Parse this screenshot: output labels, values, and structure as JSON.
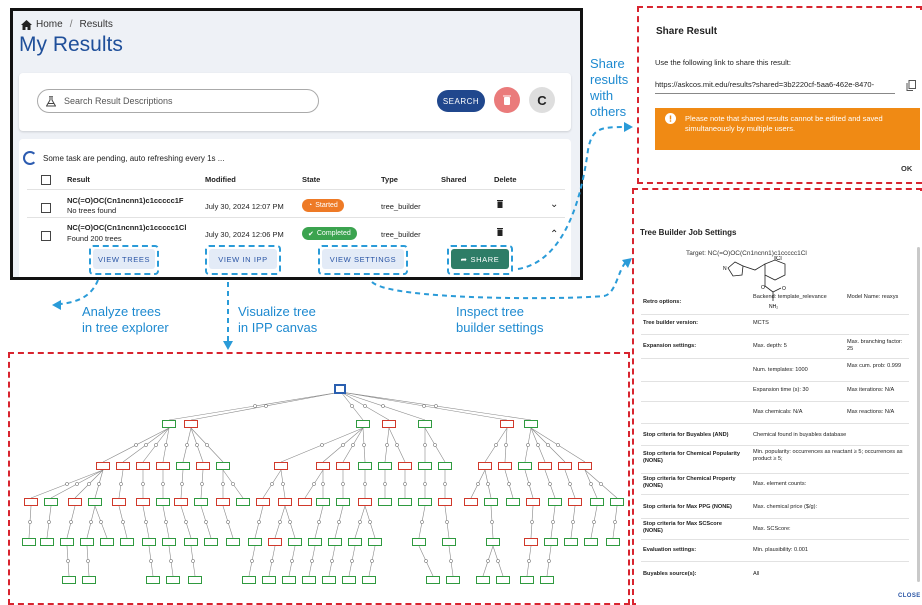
{
  "main": {
    "breadcrumb": {
      "home": "Home",
      "sep": "/",
      "current": "Results"
    },
    "title": "My Results",
    "search": {
      "placeholder": "Search Result Descriptions",
      "button": "SEARCH"
    },
    "pending_text": "Some task are pending, auto refreshing every 1s ...",
    "columns": [
      "Result",
      "Modified",
      "State",
      "Type",
      "Shared",
      "Delete"
    ],
    "rows": [
      {
        "result": "NC(=O)OC(Cn1ncnn1)c1ccccc1F",
        "sub": "No trees found",
        "modified": "July 30, 2024 12:07 PM",
        "state": "Started",
        "type": "tree_builder",
        "chevron": "⌄"
      },
      {
        "result": "NC(=O)OC(Cn1ncnn1)c1ccccc1Cl",
        "sub": "Found 200 trees",
        "modified": "July 30, 2024 12:06 PM",
        "state": "Completed",
        "type": "tree_builder",
        "chevron": "⌃"
      }
    ],
    "actions": {
      "view_trees": "VIEW TREES",
      "view_ipp": "VIEW IN IPP",
      "view_settings": "VIEW SETTINGS",
      "share": "SHARE"
    },
    "colors": {
      "started": "#ee7a26",
      "completed": "#3ba34f",
      "title": "#1f4f9a"
    }
  },
  "annotations": {
    "share": "Share\nresults\nwith\nothers",
    "trees": "Analyze trees\nin tree explorer",
    "ipp": "Visualize tree\nin IPP canvas",
    "settings": "Inspect tree\nbuilder settings"
  },
  "share_dialog": {
    "title": "Share Result",
    "instruction": "Use the following link to share this result:",
    "link": "https://askcos.mit.edu/results?shared=3b2220cf-5aa6-462e-8470-",
    "warning": "Please note that shared results cannot be edited and saved simultaneously by multiple users.",
    "ok": "OK"
  },
  "settings_dialog": {
    "title": "Tree Builder Job Settings",
    "target": "Target: NC(=O)OC(Cn1ncnn1)c1ccccc1Cl",
    "rows": [
      {
        "label": "Retro options:",
        "v1": "Backend: template_relevance",
        "v2": "Model Name: reaxys"
      },
      {
        "label": "Tree builder version:",
        "v1": "MCTS",
        "v2": ""
      },
      {
        "label": "Expansion settings:",
        "v1": "Max. depth: 5",
        "v2": "Max. branching factor: 25"
      },
      {
        "label": "",
        "v1": "Num. templates: 1000",
        "v2": "Max cum. prob: 0.999"
      },
      {
        "label": "",
        "v1": "Expansion time (s): 30",
        "v2": "Max iterations: N/A"
      },
      {
        "label": "",
        "v1": "Max chemicals: N/A",
        "v2": "Max reactions: N/A"
      },
      {
        "label": "Stop criteria for Buyables (AND)",
        "v1": "Chemical found in buyables database",
        "v2": ""
      },
      {
        "label": "Stop criteria for Chemical Popularity (NONE)",
        "v1": "Min. popularity: occurrences as reactant ≥ 5; occurrences as product ≥ 5;",
        "v2": ""
      },
      {
        "label": "Stop criteria for Chemical Property (NONE)",
        "v1": "Max. element counts:",
        "v2": ""
      },
      {
        "label": "Stop criteria for Max PPG (NONE)",
        "v1": "Max. chemical price ($/g):",
        "v2": ""
      },
      {
        "label": "Stop criteria for Max SCScore (NONE)",
        "v1": "Max. SCScore:",
        "v2": ""
      },
      {
        "label": "Evaluation settings:",
        "v1": "Min. plausibility: 0.001",
        "v2": ""
      },
      {
        "label": "Buyables source(s):",
        "v1": "All",
        "v2": ""
      }
    ],
    "close": "CLOSE",
    "molecule_labels": {
      "cl": "Cl",
      "n": "N",
      "o": "O",
      "nh2": "NH₂"
    }
  }
}
